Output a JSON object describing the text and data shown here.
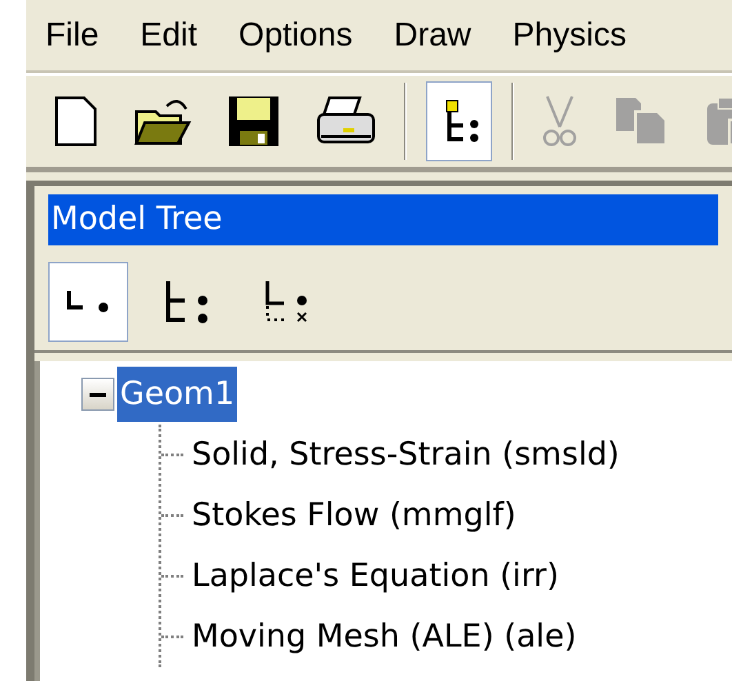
{
  "menu": [
    "File",
    "Edit",
    "Options",
    "Draw",
    "Physics"
  ],
  "toolbar": [
    {
      "kind": "button",
      "selected": false,
      "disabled": false
    },
    {
      "kind": "button",
      "selected": false,
      "disabled": false
    },
    {
      "kind": "button",
      "selected": false,
      "disabled": false
    },
    {
      "kind": "button",
      "selected": false,
      "disabled": false
    },
    {
      "kind": "separator"
    },
    {
      "kind": "button",
      "selected": true,
      "disabled": false
    },
    {
      "kind": "separator"
    },
    {
      "kind": "button",
      "selected": false,
      "disabled": true
    },
    {
      "kind": "button",
      "selected": false,
      "disabled": true
    },
    {
      "kind": "button",
      "selected": false,
      "disabled": true
    }
  ],
  "model_tree": {
    "title": "Model Tree",
    "views": [
      {
        "selected": true
      },
      {
        "selected": false
      },
      {
        "selected": false
      }
    ],
    "tree": [
      {
        "label": "Geom1",
        "expanded": true,
        "selected": true,
        "children": [
          {
            "label": "Solid, Stress-Strain (smsld)",
            "selected": false
          },
          {
            "label": "Stokes Flow (mmglf)",
            "selected": false
          },
          {
            "label": "Laplace's Equation (irr)",
            "selected": false
          },
          {
            "label": "Moving Mesh (ALE) (ale)",
            "selected": false
          }
        ]
      }
    ]
  }
}
